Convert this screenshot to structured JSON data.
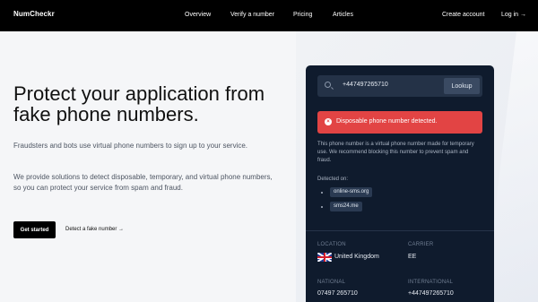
{
  "nav": {
    "logo": "NumCheckr",
    "links": [
      "Overview",
      "Verify a number",
      "Pricing",
      "Articles"
    ],
    "create_account": "Create account",
    "login": "Log in →"
  },
  "hero": {
    "title": "Protect your application from fake phone numbers.",
    "p1": "Fraudsters and bots use virtual phone numbers to sign up to your service.",
    "p2": "We provide solutions to detect disposable, temporary, and virtual phone numbers, so you can protect your service from spam and fraud.",
    "cta_primary": "Get started",
    "cta_secondary": "Detect a fake number →"
  },
  "card": {
    "search_value": "+447497265710",
    "lookup_label": "Lookup",
    "alert_icon": "x-circle-icon",
    "alert_text": "Disposable phone number detected.",
    "description": "This phone number is a virtual phone number made for temporary use. We recommend blocking this number to prevent spam and fraud.",
    "detected_label": "Detected on:",
    "detected_sites": [
      "online-sms.org",
      "sms24.me"
    ],
    "location_label": "LOCATION",
    "location_value": "United Kingdom",
    "carrier_label": "CARRIER",
    "carrier_value": "EE",
    "national_label": "NATIONAL",
    "national_value": "07497 265710",
    "international_label": "INTERNATIONAL",
    "international_value": "+447497265710"
  },
  "colors": {
    "nav_bg": "#000000",
    "card_bg": "#0f1b2d",
    "alert_bg": "#e24444",
    "page_bg": "#f5f6f8"
  }
}
